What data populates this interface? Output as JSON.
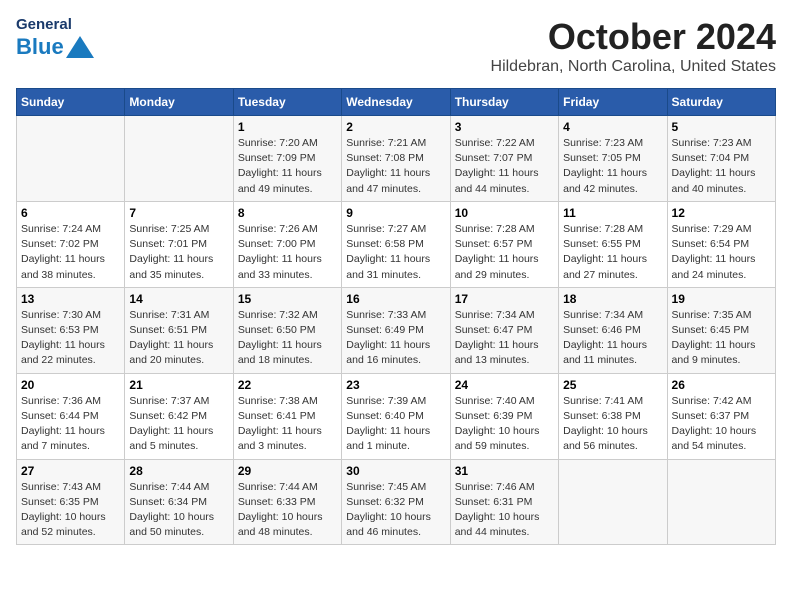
{
  "header": {
    "logo_general": "General",
    "logo_blue": "Blue",
    "title": "October 2024",
    "subtitle": "Hildebran, North Carolina, United States"
  },
  "weekdays": [
    "Sunday",
    "Monday",
    "Tuesday",
    "Wednesday",
    "Thursday",
    "Friday",
    "Saturday"
  ],
  "weeks": [
    [
      {
        "num": "",
        "info": ""
      },
      {
        "num": "",
        "info": ""
      },
      {
        "num": "1",
        "info": "Sunrise: 7:20 AM\nSunset: 7:09 PM\nDaylight: 11 hours\nand 49 minutes."
      },
      {
        "num": "2",
        "info": "Sunrise: 7:21 AM\nSunset: 7:08 PM\nDaylight: 11 hours\nand 47 minutes."
      },
      {
        "num": "3",
        "info": "Sunrise: 7:22 AM\nSunset: 7:07 PM\nDaylight: 11 hours\nand 44 minutes."
      },
      {
        "num": "4",
        "info": "Sunrise: 7:23 AM\nSunset: 7:05 PM\nDaylight: 11 hours\nand 42 minutes."
      },
      {
        "num": "5",
        "info": "Sunrise: 7:23 AM\nSunset: 7:04 PM\nDaylight: 11 hours\nand 40 minutes."
      }
    ],
    [
      {
        "num": "6",
        "info": "Sunrise: 7:24 AM\nSunset: 7:02 PM\nDaylight: 11 hours\nand 38 minutes."
      },
      {
        "num": "7",
        "info": "Sunrise: 7:25 AM\nSunset: 7:01 PM\nDaylight: 11 hours\nand 35 minutes."
      },
      {
        "num": "8",
        "info": "Sunrise: 7:26 AM\nSunset: 7:00 PM\nDaylight: 11 hours\nand 33 minutes."
      },
      {
        "num": "9",
        "info": "Sunrise: 7:27 AM\nSunset: 6:58 PM\nDaylight: 11 hours\nand 31 minutes."
      },
      {
        "num": "10",
        "info": "Sunrise: 7:28 AM\nSunset: 6:57 PM\nDaylight: 11 hours\nand 29 minutes."
      },
      {
        "num": "11",
        "info": "Sunrise: 7:28 AM\nSunset: 6:55 PM\nDaylight: 11 hours\nand 27 minutes."
      },
      {
        "num": "12",
        "info": "Sunrise: 7:29 AM\nSunset: 6:54 PM\nDaylight: 11 hours\nand 24 minutes."
      }
    ],
    [
      {
        "num": "13",
        "info": "Sunrise: 7:30 AM\nSunset: 6:53 PM\nDaylight: 11 hours\nand 22 minutes."
      },
      {
        "num": "14",
        "info": "Sunrise: 7:31 AM\nSunset: 6:51 PM\nDaylight: 11 hours\nand 20 minutes."
      },
      {
        "num": "15",
        "info": "Sunrise: 7:32 AM\nSunset: 6:50 PM\nDaylight: 11 hours\nand 18 minutes."
      },
      {
        "num": "16",
        "info": "Sunrise: 7:33 AM\nSunset: 6:49 PM\nDaylight: 11 hours\nand 16 minutes."
      },
      {
        "num": "17",
        "info": "Sunrise: 7:34 AM\nSunset: 6:47 PM\nDaylight: 11 hours\nand 13 minutes."
      },
      {
        "num": "18",
        "info": "Sunrise: 7:34 AM\nSunset: 6:46 PM\nDaylight: 11 hours\nand 11 minutes."
      },
      {
        "num": "19",
        "info": "Sunrise: 7:35 AM\nSunset: 6:45 PM\nDaylight: 11 hours\nand 9 minutes."
      }
    ],
    [
      {
        "num": "20",
        "info": "Sunrise: 7:36 AM\nSunset: 6:44 PM\nDaylight: 11 hours\nand 7 minutes."
      },
      {
        "num": "21",
        "info": "Sunrise: 7:37 AM\nSunset: 6:42 PM\nDaylight: 11 hours\nand 5 minutes."
      },
      {
        "num": "22",
        "info": "Sunrise: 7:38 AM\nSunset: 6:41 PM\nDaylight: 11 hours\nand 3 minutes."
      },
      {
        "num": "23",
        "info": "Sunrise: 7:39 AM\nSunset: 6:40 PM\nDaylight: 11 hours\nand 1 minute."
      },
      {
        "num": "24",
        "info": "Sunrise: 7:40 AM\nSunset: 6:39 PM\nDaylight: 10 hours\nand 59 minutes."
      },
      {
        "num": "25",
        "info": "Sunrise: 7:41 AM\nSunset: 6:38 PM\nDaylight: 10 hours\nand 56 minutes."
      },
      {
        "num": "26",
        "info": "Sunrise: 7:42 AM\nSunset: 6:37 PM\nDaylight: 10 hours\nand 54 minutes."
      }
    ],
    [
      {
        "num": "27",
        "info": "Sunrise: 7:43 AM\nSunset: 6:35 PM\nDaylight: 10 hours\nand 52 minutes."
      },
      {
        "num": "28",
        "info": "Sunrise: 7:44 AM\nSunset: 6:34 PM\nDaylight: 10 hours\nand 50 minutes."
      },
      {
        "num": "29",
        "info": "Sunrise: 7:44 AM\nSunset: 6:33 PM\nDaylight: 10 hours\nand 48 minutes."
      },
      {
        "num": "30",
        "info": "Sunrise: 7:45 AM\nSunset: 6:32 PM\nDaylight: 10 hours\nand 46 minutes."
      },
      {
        "num": "31",
        "info": "Sunrise: 7:46 AM\nSunset: 6:31 PM\nDaylight: 10 hours\nand 44 minutes."
      },
      {
        "num": "",
        "info": ""
      },
      {
        "num": "",
        "info": ""
      }
    ]
  ]
}
